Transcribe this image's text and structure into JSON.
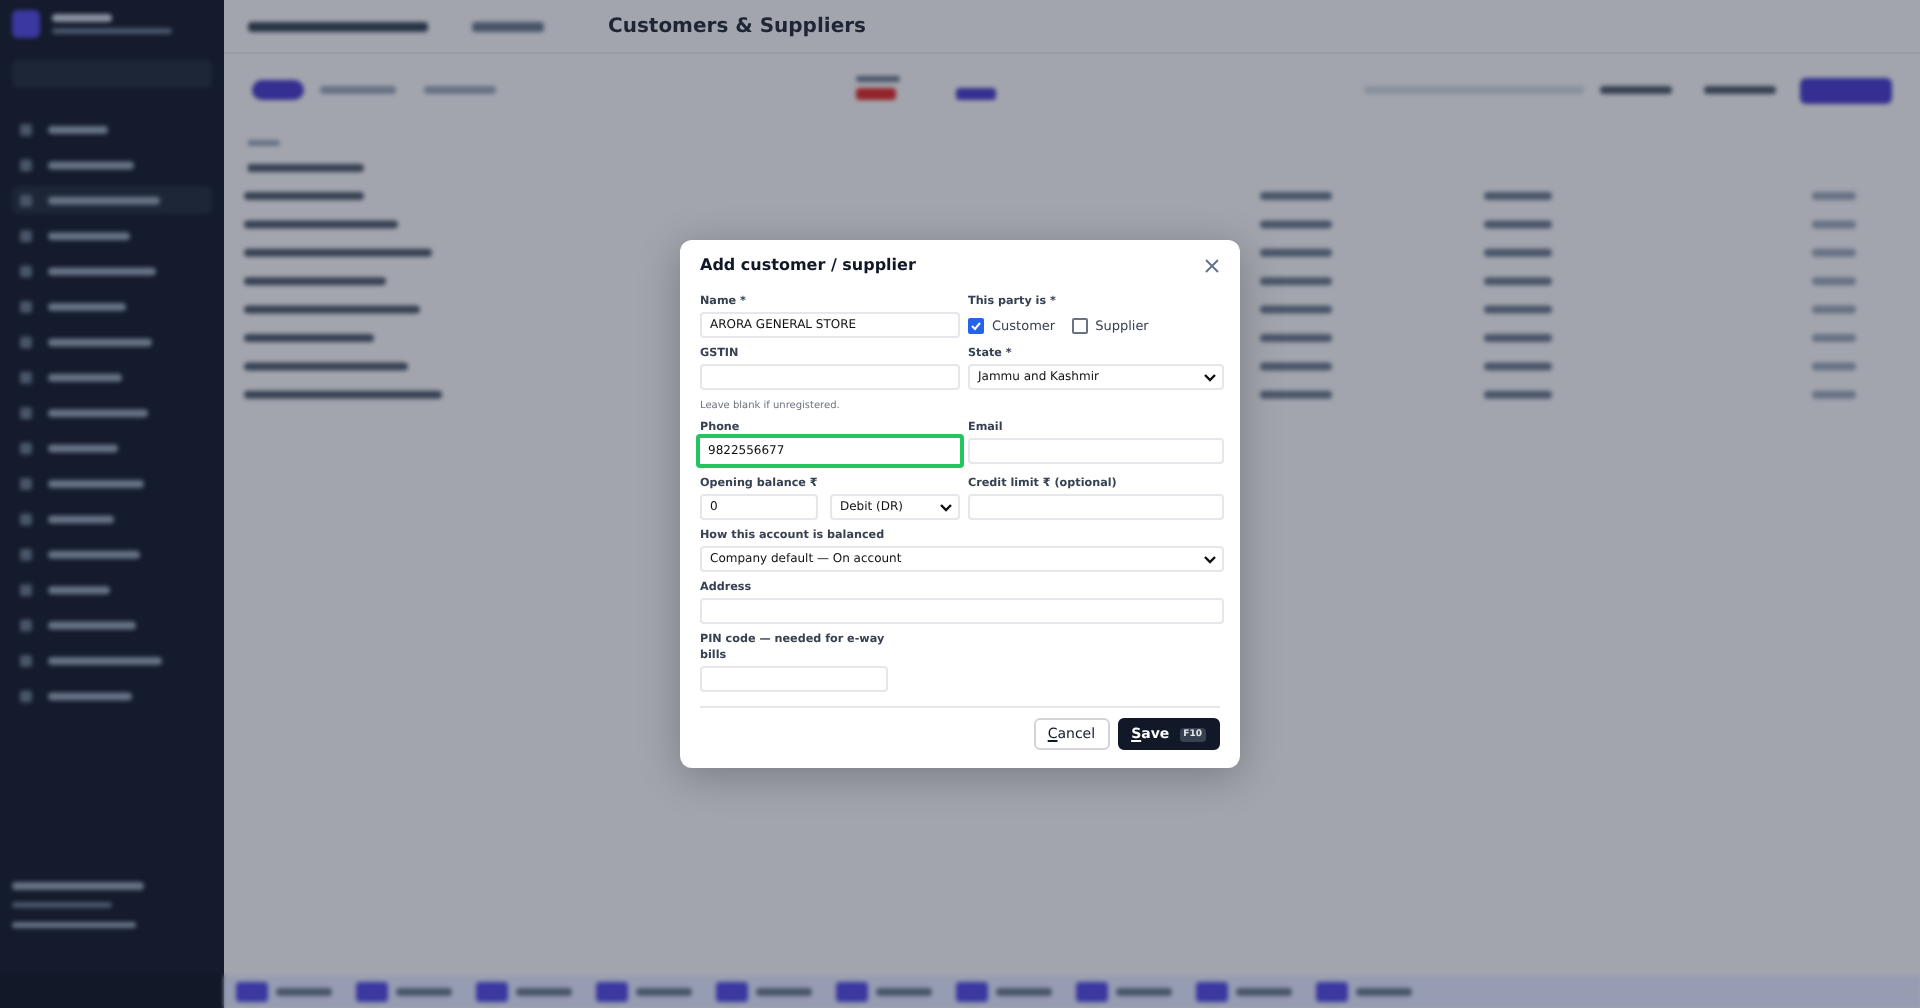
{
  "backdrop": {
    "page_title": "Customers & Suppliers"
  },
  "dialog": {
    "title": "Add customer / supplier",
    "name": {
      "label": "Name *",
      "value": "ARORA GENERAL STORE"
    },
    "party": {
      "label": "This party is *",
      "options": [
        {
          "label": "Customer",
          "checked": true
        },
        {
          "label": "Supplier",
          "checked": false
        }
      ]
    },
    "gstin": {
      "label": "GSTIN",
      "hint": "Leave blank if unregistered."
    },
    "state": {
      "label": "State *",
      "value": "Jammu and Kashmir"
    },
    "phone": {
      "label": "Phone",
      "value": "9822556677",
      "focused": true
    },
    "email": {
      "label": "Email"
    },
    "opening_balance": {
      "label": "Opening balance ₹",
      "value": "0",
      "side": "Debit (DR)"
    },
    "credit_limit": {
      "label": "Credit limit ₹ (optional)"
    },
    "balancing": {
      "label": "How this account is balanced",
      "value": "Company default — On account"
    },
    "address": {
      "label": "Address"
    },
    "pin": {
      "label": "PIN code — needed for e-way bills"
    },
    "buttons": [
      {
        "kind": "secondary",
        "label": "Cancel"
      },
      {
        "kind": "primary",
        "label": "Save",
        "shortcut": "F10"
      }
    ]
  }
}
